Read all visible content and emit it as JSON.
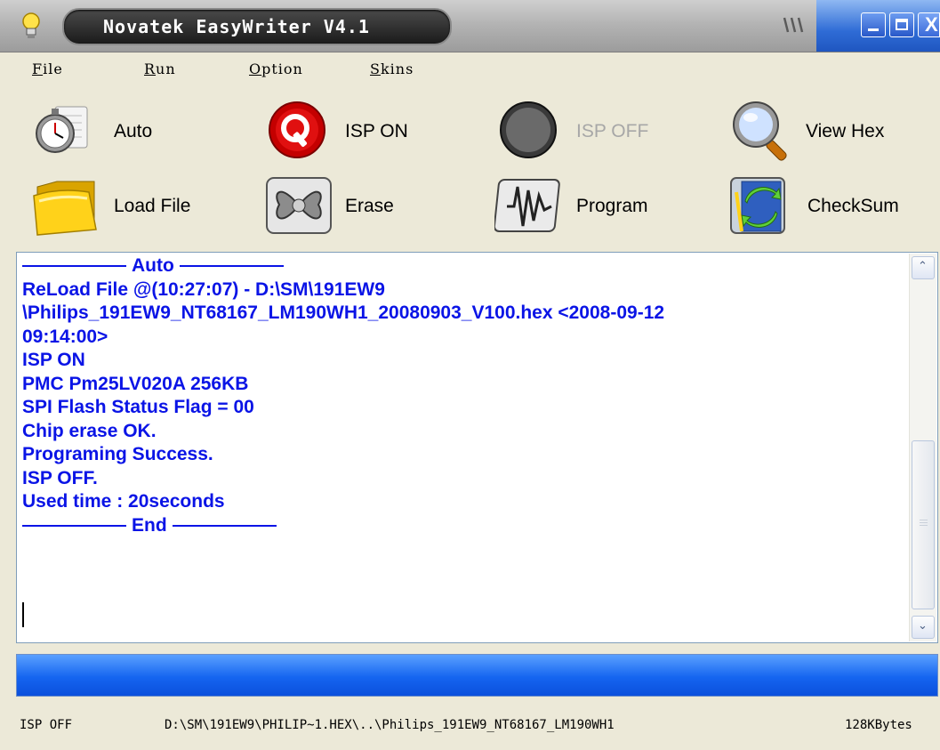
{
  "window": {
    "title": "Novatek EasyWriter V4.1",
    "accent_color": "#2f6cd6",
    "controls": {
      "minimize_icon": "minimize-icon",
      "maximize_icon": "maximize-icon",
      "close_label": "X"
    }
  },
  "menu": {
    "items": [
      {
        "label": "File"
      },
      {
        "label": "Run"
      },
      {
        "label": "Option"
      },
      {
        "label": "Skins"
      }
    ]
  },
  "toolbar": {
    "buttons": [
      {
        "label": "Auto",
        "icon": "stopwatch-icon",
        "enabled": true
      },
      {
        "label": "ISP ON",
        "icon": "isp-on-icon",
        "enabled": true
      },
      {
        "label": "ISP OFF",
        "icon": "isp-off-moon-icon",
        "enabled": true
      },
      {
        "label": "View Hex",
        "icon": "magnifier-icon",
        "enabled": true
      },
      {
        "label": "Load File",
        "icon": "folder-icon",
        "enabled": true
      },
      {
        "label": "Erase",
        "icon": "erase-icon",
        "enabled": false
      },
      {
        "label": "Program",
        "icon": "program-icon",
        "enabled": false
      },
      {
        "label": "CheckSum",
        "icon": "checksum-icon",
        "enabled": true
      }
    ]
  },
  "log": {
    "text_color": "#0a14e6",
    "header": "Auto",
    "lines": [
      "ReLoad File @(10:27:07) - D:\\SM\\191EW9",
      "\\Philips_191EW9_NT68167_LM190WH1_20080903_V100.hex <2008-09-12",
      "09:14:00>",
      "ISP ON",
      "PMC Pm25LV020A 256KB",
      "SPI Flash Status Flag = 00",
      "Chip erase OK.",
      "Programing Success.",
      "ISP OFF.",
      "Used time : 20seconds"
    ],
    "footer": "End"
  },
  "progress": {
    "value": 1.0
  },
  "status": {
    "state": "ISP OFF",
    "path": "D:\\SM\\191EW9\\PHILIP~1.HEX\\..\\Philips_191EW9_NT68167_LM190WH1",
    "size": "128KBytes"
  }
}
